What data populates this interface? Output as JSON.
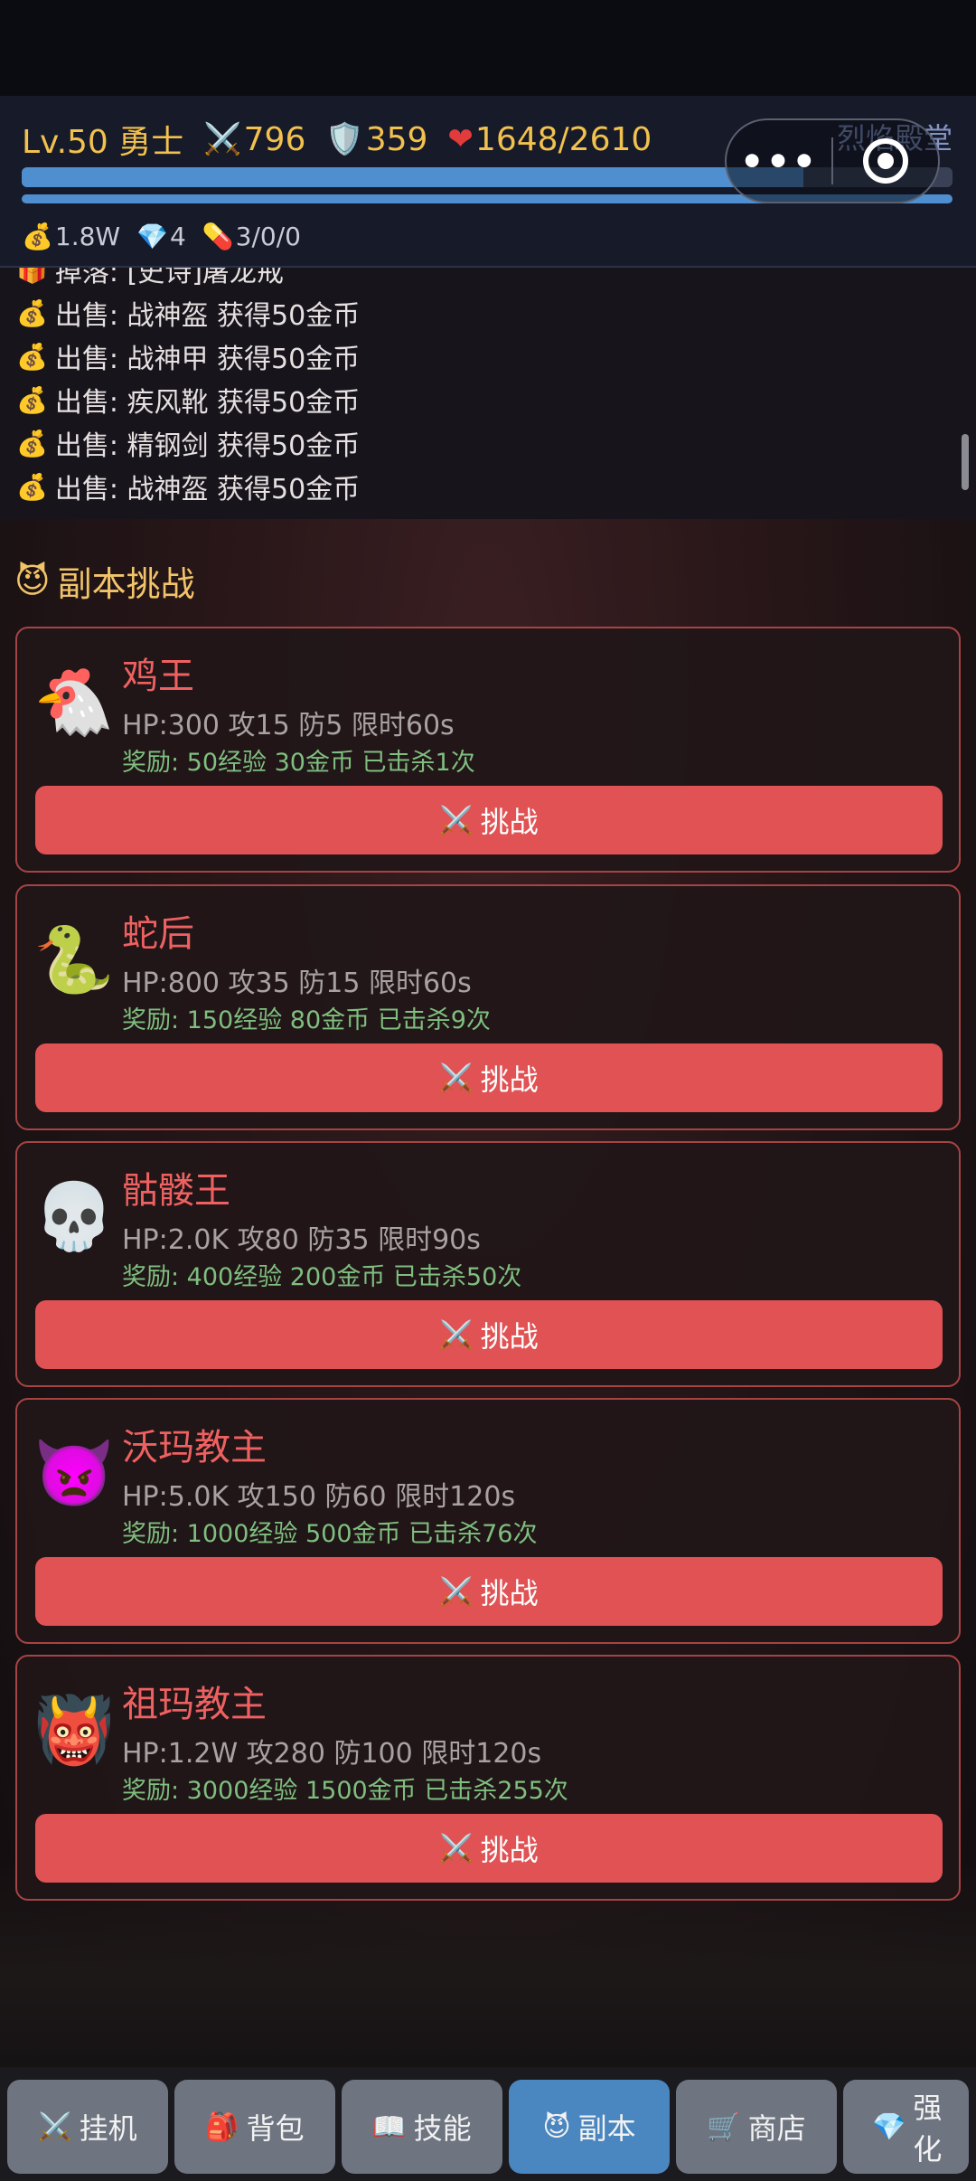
{
  "header": {
    "level": "Lv.50",
    "class_name": "勇士",
    "attack": "796",
    "defense": "359",
    "hp": "1648/2610",
    "game_title": "烈焰殿堂",
    "exp_progress": 0.84,
    "hp_progress": 1.0,
    "gold": "1.8W",
    "diamonds": "4",
    "potions": "3/0/0",
    "icons": {
      "attack": "crossed-swords-icon",
      "defense": "shield-icon",
      "hp": "heart-icon",
      "gold": "money-bag-icon",
      "diamond": "gem-icon",
      "potion": "pill-icon"
    }
  },
  "capsule": {
    "more_label": "•••"
  },
  "log": {
    "lines": [
      {
        "icon": "🎁",
        "text": "掉落: [史诗]屠龙戒"
      },
      {
        "icon": "💰",
        "text": "出售: 战神盔  获得50金币"
      },
      {
        "icon": "💰",
        "text": "出售: 战神甲  获得50金币"
      },
      {
        "icon": "💰",
        "text": "出售: 疾风靴  获得50金币"
      },
      {
        "icon": "💰",
        "text": "出售: 精钢剑  获得50金币"
      },
      {
        "icon": "💰",
        "text": "出售: 战神盔  获得50金币"
      }
    ]
  },
  "section": {
    "icon": "😈",
    "title": "副本挑战"
  },
  "bosses": [
    {
      "avatar": "🐔",
      "avatar_name": "chicken-icon",
      "name": "鸡王",
      "info": "HP:300 攻15 防5  限时60s",
      "reward": "奖励: 50经验 30金币  已击杀1次",
      "button": "挑战"
    },
    {
      "avatar": "🐍",
      "avatar_name": "snake-icon",
      "name": "蛇后",
      "info": "HP:800 攻35 防15  限时60s",
      "reward": "奖励: 150经验 80金币  已击杀9次",
      "button": "挑战"
    },
    {
      "avatar": "💀",
      "avatar_name": "skull-icon",
      "name": "骷髅王",
      "info": "HP:2.0K 攻80 防35  限时90s",
      "reward": "奖励: 400经验 200金币  已击杀50次",
      "button": "挑战"
    },
    {
      "avatar": "👿",
      "avatar_name": "devil-icon",
      "name": "沃玛教主",
      "info": "HP:5.0K 攻150 防60  限时120s",
      "reward": "奖励: 1000经验 500金币  已击杀76次",
      "button": "挑战"
    },
    {
      "avatar": "👹",
      "avatar_name": "ogre-icon",
      "name": "祖玛教主",
      "info": "HP:1.2W 攻280 防100  限时120s",
      "reward": "奖励: 3000经验 1500金币  已击杀255次",
      "button": "挑战"
    }
  ],
  "button_icon": "⚔️",
  "tabs": [
    {
      "icon": "⚔️",
      "label": "挂机",
      "active": false
    },
    {
      "icon": "🎒",
      "label": "背包",
      "active": false
    },
    {
      "icon": "📖",
      "label": "技能",
      "active": false
    },
    {
      "icon": "😈",
      "label": "副本",
      "active": true
    },
    {
      "icon": "🛒",
      "label": "商店",
      "active": false
    },
    {
      "icon": "💎",
      "label": "强化",
      "active": false
    }
  ]
}
